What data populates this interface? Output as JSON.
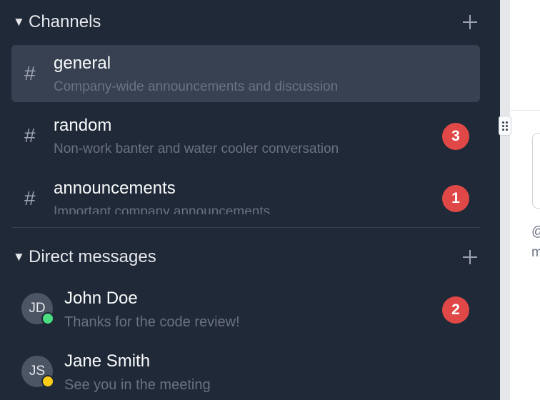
{
  "channels_section": {
    "caret": "▼",
    "title": "Channels"
  },
  "channels": [
    {
      "hash": "#",
      "name": "general",
      "description": "Company-wide announcements and discussion",
      "unread": ""
    },
    {
      "hash": "#",
      "name": "random",
      "description": "Non-work banter and water cooler conversation",
      "unread": "3"
    },
    {
      "hash": "#",
      "name": "announcements",
      "description": "Important company announcements",
      "unread": "1"
    }
  ],
  "dm_section": {
    "caret": "▼",
    "title": "Direct messages"
  },
  "direct_messages": [
    {
      "initials": "JD",
      "name": "John Doe",
      "preview": "Thanks for the code review!",
      "unread": "2",
      "status_color": "#4ade80"
    },
    {
      "initials": "JS",
      "name": "Jane Smith",
      "preview": "See you in the meeting",
      "unread": "",
      "status_color": "#facc15"
    }
  ],
  "right_pane": {
    "mention_fragment": "@",
    "text_fragment": "m"
  },
  "colors": {
    "sidebar_bg": "#1f2937",
    "active_bg": "#374151",
    "badge": "#e04848"
  }
}
